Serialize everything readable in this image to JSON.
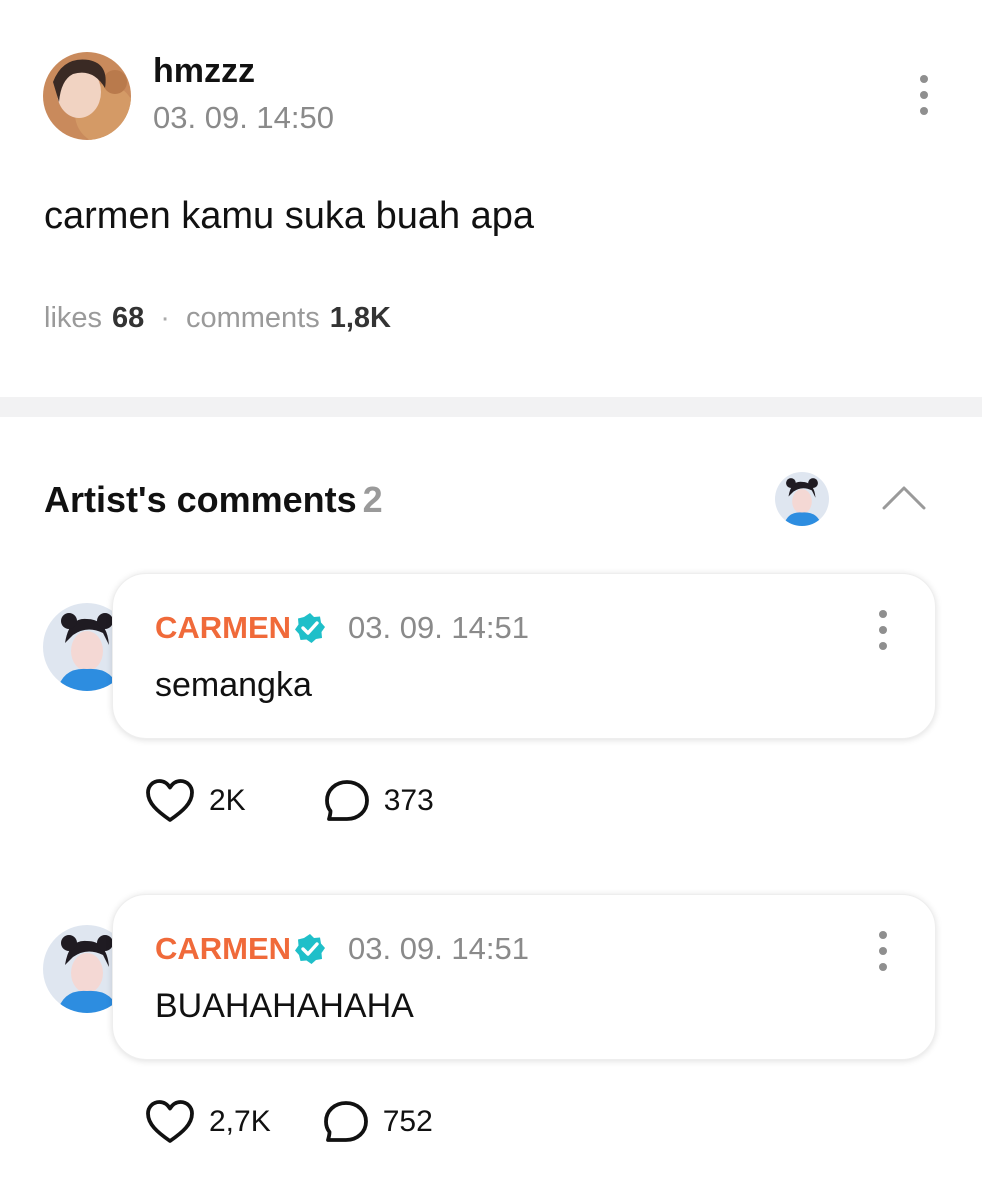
{
  "post": {
    "author": "hmzzz",
    "timestamp": "03. 09. 14:50",
    "body": "carmen kamu suka buah apa",
    "stats": {
      "likes_label": "likes",
      "likes_value": "68",
      "separator": "·",
      "comments_label": "comments",
      "comments_value": "1,8K"
    }
  },
  "artist_comments": {
    "title": "Artist's comments",
    "count": "2",
    "items": [
      {
        "name": "CARMEN",
        "timestamp": "03. 09. 14:51",
        "text": "semangka",
        "likes": "2K",
        "replies": "373"
      },
      {
        "name": "CARMEN",
        "timestamp": "03. 09. 14:51",
        "text": "BUAHAHAHAHA",
        "likes": "2,7K",
        "replies": "752"
      }
    ]
  },
  "colors": {
    "artist_name": "#f06a3a",
    "verified_badge": "#1fbfc9",
    "muted_text": "#8a8a8a",
    "divider": "#f2f2f3"
  },
  "icons": [
    "more-vertical-icon",
    "chevron-up-icon",
    "verified-badge-icon",
    "heart-icon",
    "comment-bubble-icon"
  ]
}
